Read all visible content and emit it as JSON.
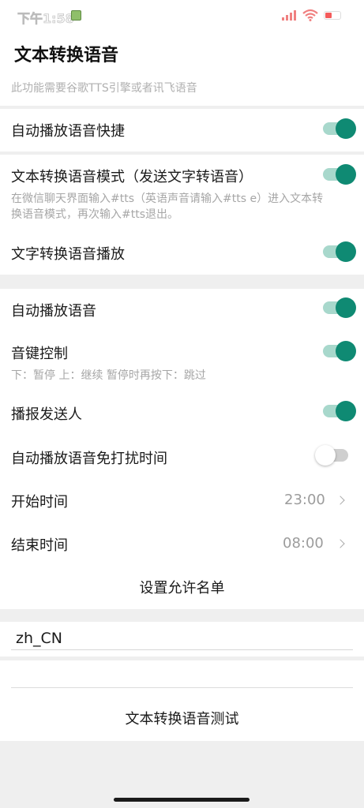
{
  "status": {
    "time": "下午1:58"
  },
  "header": {
    "title": "文本转换语音"
  },
  "tts_notice": "此功能需要谷歌TTS引擎或者讯飞语音",
  "settings": {
    "auto_play_shortcut": {
      "label": "自动播放语音快捷",
      "enabled": true
    },
    "tts_mode": {
      "label": "文本转换语音模式（发送文字转语音）",
      "desc_line1": "在微信聊天界面输入#tts（英语声音请输入#tts e）进入文本转",
      "desc_line2": "换语音模式，再次输入#tts退出。",
      "enabled": true
    },
    "text_to_speech_play": {
      "label": "文字转换语音播放",
      "enabled": true
    },
    "auto_play_voice": {
      "label": "自动播放语音",
      "enabled": true
    },
    "volume_key_control": {
      "label": "音键控制",
      "desc": "下：暂停 上：继续 暂停时再按下：跳过",
      "enabled": true
    },
    "announce_sender": {
      "label": "播报发送人",
      "enabled": true
    },
    "dnd_time": {
      "label": "自动播放语音免打扰时间",
      "enabled": false
    },
    "start_time": {
      "label": "开始时间",
      "value": "23:00"
    },
    "end_time": {
      "label": "结束时间",
      "value": "08:00"
    },
    "allowlist": {
      "label": "设置允许名单"
    }
  },
  "locale": {
    "value": "zh_CN"
  },
  "test_button": {
    "label": "文本转换语音测试"
  },
  "colors": {
    "accent": "#0f8a73",
    "accent_track": "#a8d8cc",
    "background": "#efefef"
  }
}
